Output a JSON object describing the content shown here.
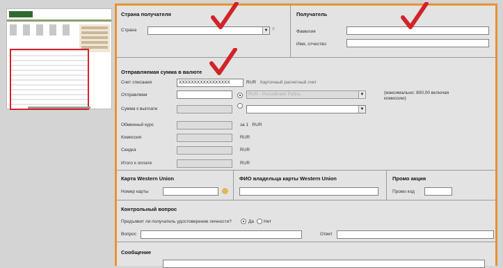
{
  "recipient_country": {
    "title": "Страна получателя",
    "country_label": "Страна",
    "country_value": ""
  },
  "recipient": {
    "title": "Получатель",
    "surname_label": "Фамилия",
    "surname_value": "",
    "name_label": "Имя, отчество",
    "name_value": ""
  },
  "sent_amount": {
    "title": "Отправляемая сумма в валюте",
    "debit_account_label": "Счет списания",
    "debit_account_value": "XXXXXXXXXXXXXXXXX",
    "debit_currency": "RUR",
    "debit_account_type": "Карточный расчетный счет",
    "send_label": "Отправляем",
    "send_currency": "RUR - Российский Рубль",
    "max_note": "(максимально: 800,00 включая комиссию)",
    "payout_label": "Сумма к выплате",
    "rate_label": "Обменный курс",
    "rate_note": "за 1   RUR",
    "commission_label": "Комиссия",
    "commission_currency": "RUR",
    "discount_label": "Скидка",
    "discount_currency": "RUR",
    "total_label": "Итого к оплате",
    "total_currency": "RUR"
  },
  "wu_card": {
    "title": "Карта Western Union",
    "number_label": "Номер карты",
    "number_value": ""
  },
  "wu_holder": {
    "title": "ФИО владельца карты Western Union",
    "value": ""
  },
  "promo": {
    "title": "Промо акция",
    "code_label": "Промо код",
    "code_value": ""
  },
  "control": {
    "title": "Контрольный вопрос",
    "question_prompt": "Предъявит ли получатель удостоверение личности?",
    "yes_label": "Да",
    "no_label": "Нет",
    "question_label": "Вопрос",
    "answer_label": "Ответ"
  },
  "message": {
    "title": "Сообщение",
    "value": ""
  },
  "colors": {
    "frame": "#e8932e",
    "check": "#d2232a",
    "panel": "#e3e3e3"
  }
}
